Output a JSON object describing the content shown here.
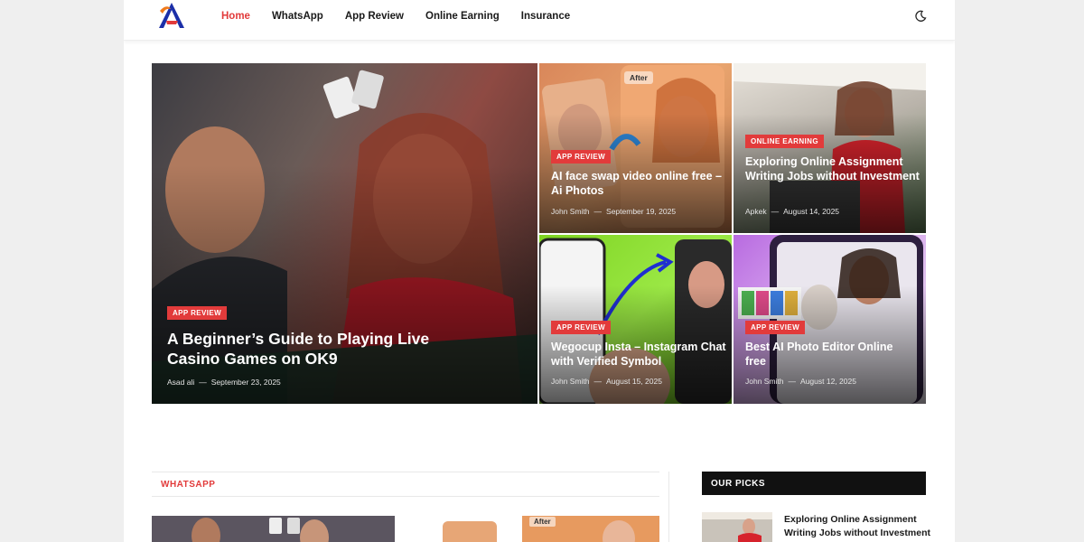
{
  "header": {
    "nav": [
      "Home",
      "WhatsApp",
      "App Review",
      "Online Earning",
      "Insurance"
    ],
    "active_index": 0
  },
  "colors": {
    "accent": "#e23b3b",
    "dark": "#111111",
    "page_bg": "#efefef"
  },
  "icons": {
    "logo": "logo-a-icon",
    "theme": "moon-icon"
  },
  "featured": [
    {
      "badge": "APP REVIEW",
      "title": "A Beginner’s Guide to Playing Live Casino Games on OK9",
      "author": "Asad ali",
      "sep": "—",
      "date": "September 23, 2025"
    },
    {
      "badge": "APP REVIEW",
      "title": "AI face swap video online free – Ai Photos",
      "author": "John Smith",
      "sep": "—",
      "date": "September 19, 2025",
      "image_text": "After"
    },
    {
      "badge": "ONLINE EARNING",
      "title": "Exploring Online Assignment Writing Jobs without Investment",
      "author": "Apkek",
      "sep": "—",
      "date": "August 14, 2025"
    },
    {
      "badge": "APP REVIEW",
      "title": "Wegocup Insta – Instagram Chat with Verified Symbol",
      "author": "John Smith",
      "sep": "—",
      "date": "August 15, 2025"
    },
    {
      "badge": "APP REVIEW",
      "title": "Best AI Photo Editor Online free",
      "author": "John Smith",
      "sep": "—",
      "date": "August 12, 2025"
    }
  ],
  "sections": {
    "whatsapp": {
      "label": "WHATSAPP",
      "thumb2_text": "After"
    },
    "picks": {
      "label": "OUR PICKS",
      "item_title": "Exploring Online Assignment Writing Jobs without Investment"
    }
  }
}
